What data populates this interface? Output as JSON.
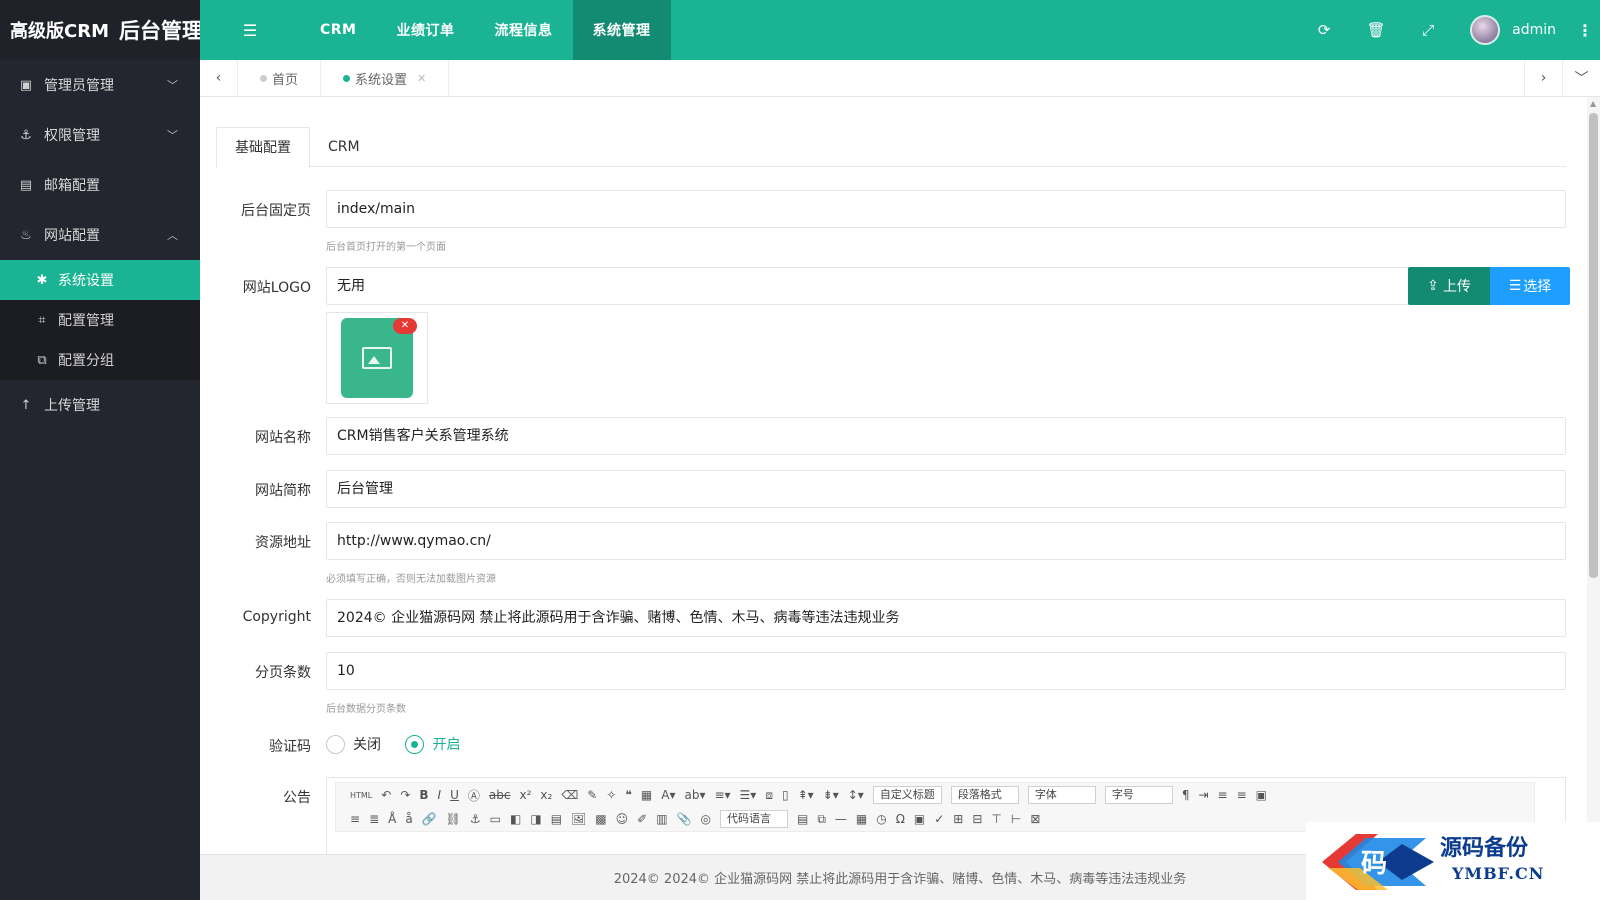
{
  "logo": {
    "part1": "高级版CRM",
    "part2": "后台管理"
  },
  "sidebar": {
    "items": [
      {
        "label": "管理员管理",
        "icon": "user-card-icon"
      },
      {
        "label": "权限管理",
        "icon": "anchor-icon"
      },
      {
        "label": "邮箱配置",
        "icon": "mailbox-icon"
      },
      {
        "label": "网站配置",
        "icon": "site-config-icon"
      }
    ],
    "sub_items": [
      {
        "label": "系统设置",
        "icon": "gear-icon"
      },
      {
        "label": "配置管理",
        "icon": "config-icon"
      },
      {
        "label": "配置分组",
        "icon": "group-icon"
      }
    ],
    "upload": {
      "label": "上传管理",
      "icon": "upload-arrow-icon"
    }
  },
  "topnav": {
    "items": [
      "CRM",
      "业绩订单",
      "流程信息",
      "系统管理"
    ],
    "active": "系统管理",
    "user": "admin"
  },
  "tabs": {
    "home": "首页",
    "active": "系统设置"
  },
  "content": {
    "tabs": [
      "基础配置",
      "CRM"
    ],
    "fields": {
      "homepage": {
        "label": "后台固定页",
        "value": "index/main",
        "hint": "后台首页打开的第一个页面"
      },
      "logo": {
        "label": "网站LOGO",
        "value": "无用",
        "upload": "上传",
        "select": "选择"
      },
      "site_name": {
        "label": "网站名称",
        "value": "CRM销售客户关系管理系统"
      },
      "site_short": {
        "label": "网站简称",
        "value": "后台管理"
      },
      "resource": {
        "label": "资源地址",
        "value": "http://www.qymao.cn/",
        "hint": "必须填写正确，否则无法加载图片资源"
      },
      "copyright": {
        "label": "Copyright",
        "value": "2024© 企业猫源码网 禁止将此源码用于含诈骗、赌博、色情、木马、病毒等违法违规业务"
      },
      "page_size": {
        "label": "分页条数",
        "value": "10",
        "hint": "后台数据分页条数"
      },
      "captcha": {
        "label": "验证码",
        "off": "关闭",
        "on": "开启",
        "selected": "开启"
      },
      "notice": {
        "label": "公告"
      }
    },
    "editor": {
      "html": "HTML",
      "selects": [
        "自定义标题",
        "段落格式",
        "字体",
        "字号",
        "代码语言"
      ]
    }
  },
  "footer": "2024© 2024© 企业猫源码网 禁止将此源码用于含诈骗、赌博、色情、木马、病毒等违法违规业务",
  "watermark": {
    "title": "源码备份",
    "domain": "YMBF.CN",
    "char": "码"
  },
  "colors": {
    "primary": "#1ab394",
    "primary_dark": "#138a72",
    "blue": "#1e9fff",
    "sidebar": "#23262e"
  }
}
